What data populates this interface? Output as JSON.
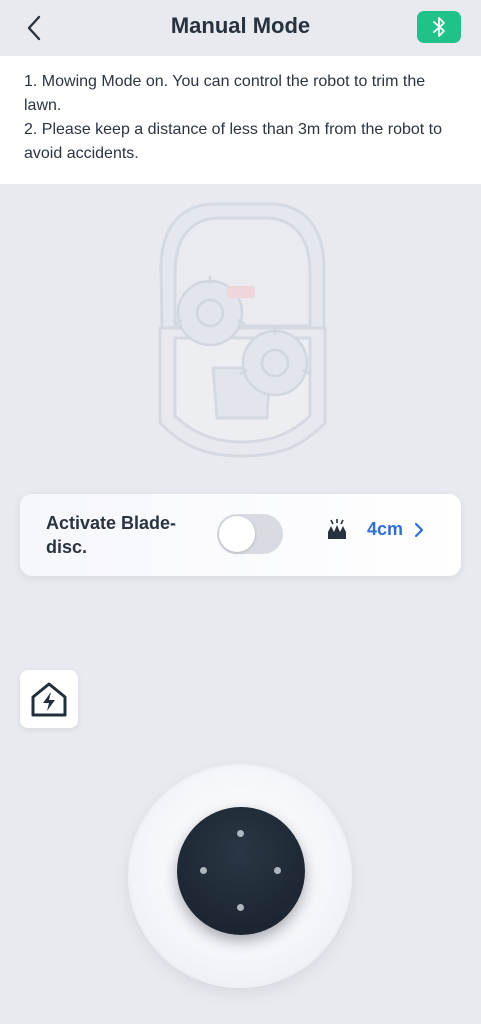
{
  "header": {
    "title": "Manual Mode",
    "back_icon": "chevron-left-icon",
    "bluetooth_icon": "bluetooth-icon",
    "bluetooth_color": "#21c28a"
  },
  "notice": {
    "line1": "1. Mowing Mode on. You can control the robot to trim the lawn.",
    "line2": "2. Please keep a distance of less than 3m from the robot to avoid accidents."
  },
  "blade": {
    "label": "Activate Blade-disc.",
    "toggle_on": false,
    "height_icon": "cutting-height-icon",
    "height_value": "4cm",
    "accent_color": "#2f6fd0"
  },
  "dock": {
    "icon": "recharge-dock-icon"
  },
  "joystick": {
    "icon": "joystick-icon"
  }
}
